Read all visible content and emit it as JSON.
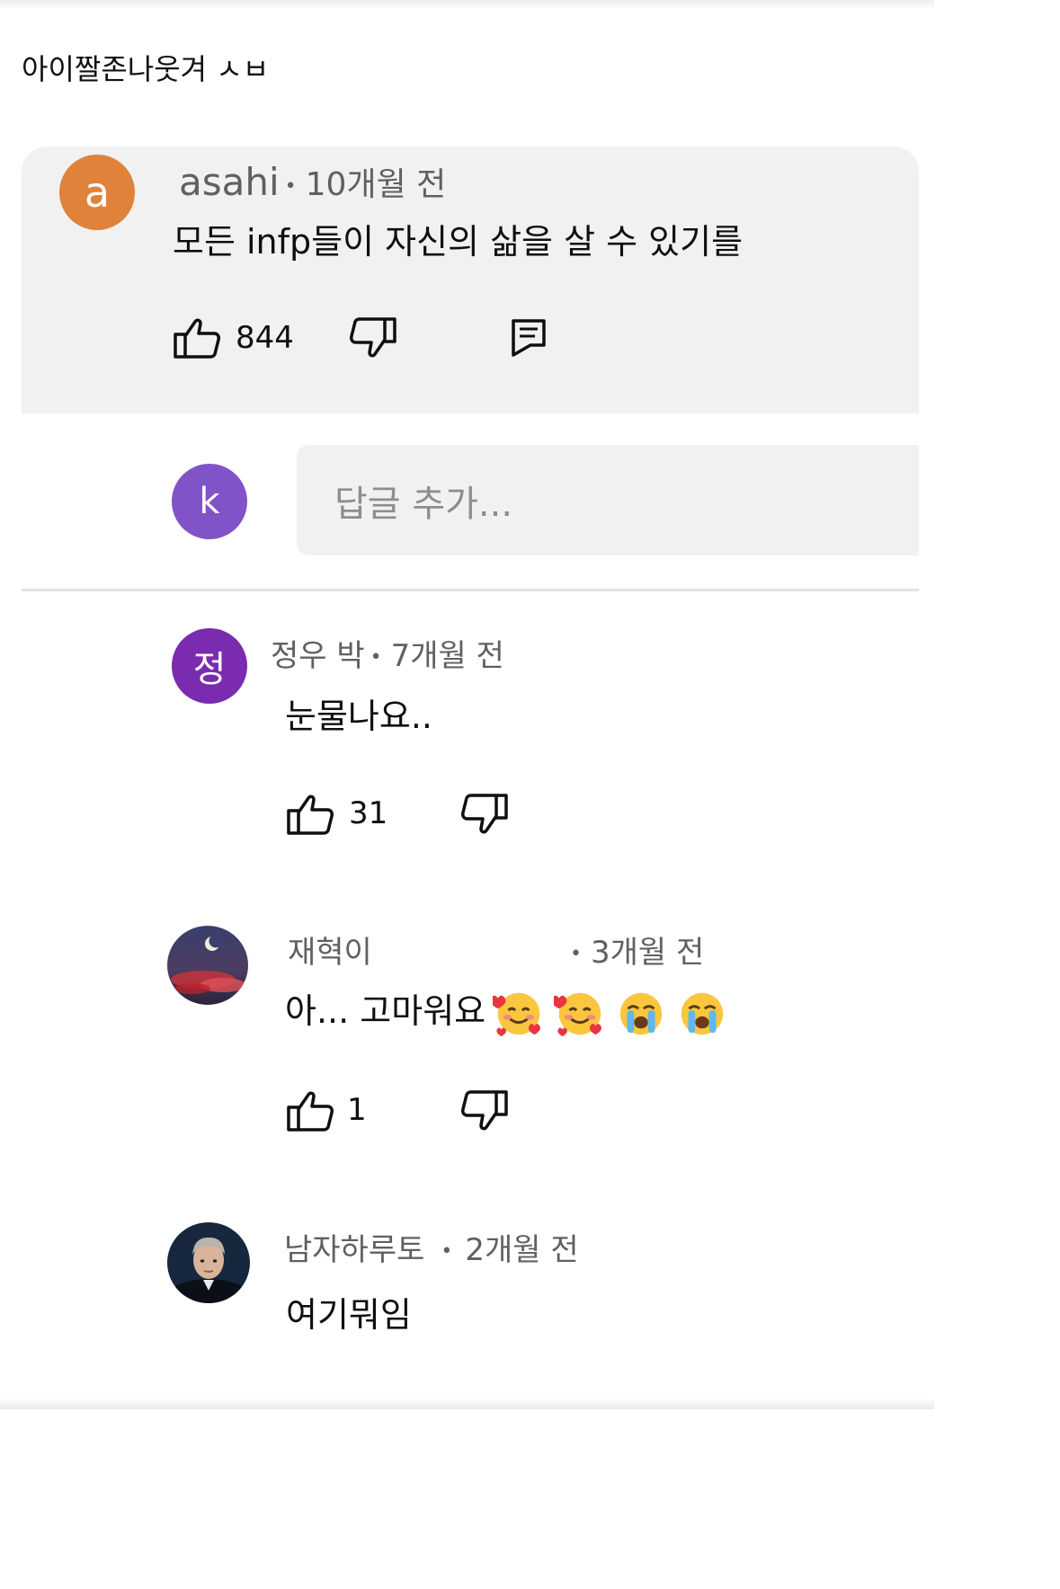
{
  "caption": "아이짤존나웃겨 ㅅㅂ",
  "parent_comment": {
    "avatar_letter": "a",
    "author": "asahi",
    "time": "10개월 전",
    "text": "모든 infp들이 자신의 삶을 살 수 있기를",
    "likes": "844",
    "icons": [
      "thumbs-up-icon",
      "thumbs-down-icon",
      "reply-icon"
    ]
  },
  "reply_input": {
    "avatar_letter": "k",
    "placeholder": "답글 추가..."
  },
  "replies": [
    {
      "avatar_letter": "정",
      "author": "정우 박",
      "time": "7개월 전",
      "text": "눈물나요..",
      "likes": "31"
    },
    {
      "author": "재혁이",
      "time": "3개월 전",
      "text": "아... 고마워요",
      "emojis": [
        "smiling-face-with-hearts",
        "smiling-face-with-hearts",
        "loudly-crying-face",
        "loudly-crying-face"
      ],
      "likes": "1"
    },
    {
      "author": "남자하루토",
      "time": "2개월 전",
      "text": "여기뭐임"
    }
  ],
  "colors": {
    "avatar_a": "#e0823a",
    "avatar_k": "#8153c9",
    "avatar_jeong": "#7b2bb0",
    "card_bg": "#f1f1f1",
    "meta_text": "#606060"
  }
}
